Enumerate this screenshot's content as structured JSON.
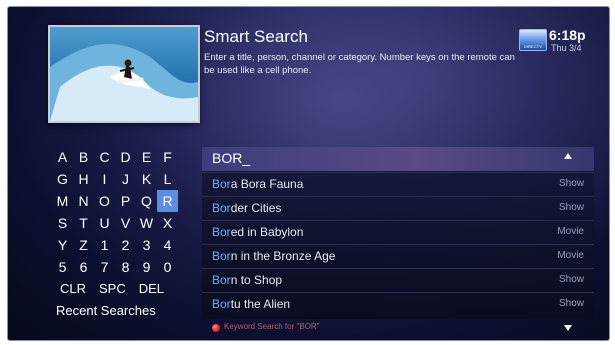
{
  "header": {
    "title": "Smart Search",
    "description": "Enter a title, person, channel or category. Number keys on the remote can be used like a cell phone.",
    "time": "6:18p",
    "date": "Thu 3/4",
    "brand_text": "DIRECTV"
  },
  "keypad": {
    "rows": [
      [
        "A",
        "B",
        "C",
        "D",
        "E",
        "F"
      ],
      [
        "G",
        "H",
        "I",
        "J",
        "K",
        "L"
      ],
      [
        "M",
        "N",
        "O",
        "P",
        "Q",
        "R"
      ],
      [
        "S",
        "T",
        "U",
        "V",
        "W",
        "X"
      ],
      [
        "Y",
        "Z",
        "1",
        "2",
        "3",
        "4"
      ],
      [
        "5",
        "6",
        "7",
        "8",
        "9",
        "0"
      ]
    ],
    "selected_key": "R",
    "actions": [
      "CLR",
      "SPC",
      "DEL"
    ],
    "recent_label": "Recent Searches"
  },
  "search": {
    "query": "BOR_",
    "results": [
      {
        "match": "Bor",
        "rest": "a Bora Fauna",
        "type": "Show"
      },
      {
        "match": "Bor",
        "rest": "der Cities",
        "type": "Show"
      },
      {
        "match": "Bor",
        "rest": "ed in Babylon",
        "type": "Movie"
      },
      {
        "match": "Bor",
        "rest": "n in the Bronze Age",
        "type": "Movie"
      },
      {
        "match": "Bor",
        "rest": "n to Shop",
        "type": "Show"
      },
      {
        "match": "Bor",
        "rest": "tu the Alien",
        "type": "Show"
      }
    ],
    "footer": "Keyword Search for \"BOR\""
  },
  "colors": {
    "highlight": "#6fb0ff",
    "selected_key": "#5c8ee0",
    "red_button": "#d01818"
  }
}
